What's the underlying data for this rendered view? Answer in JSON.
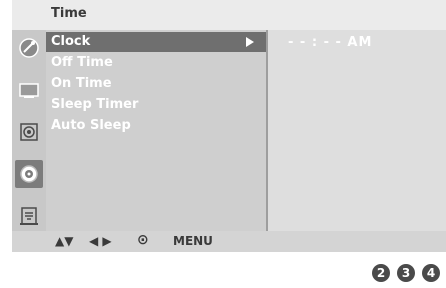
{
  "menu": {
    "title": "Time",
    "items": [
      {
        "label": "Clock",
        "selected": true
      },
      {
        "label": "Off Time",
        "selected": false
      },
      {
        "label": "On Time",
        "selected": false
      },
      {
        "label": "Sleep Timer",
        "selected": false
      },
      {
        "label": "Auto Sleep",
        "selected": false
      }
    ],
    "clock_value": "- - : - - AM"
  },
  "icons": [
    "satellite-dish-icon",
    "picture-icon",
    "sound-icon",
    "clock-icon",
    "lock-icon"
  ],
  "nav": {
    "updown": "▲▼",
    "leftright": "◀ ▶",
    "select": "⊙",
    "menu": "MENU"
  },
  "steps": [
    "2",
    "3",
    "4"
  ],
  "colors": {
    "background": "#e1e1e1",
    "selected_row": "#6f6f6f",
    "text_white": "#ffffff",
    "text_dark": "#3a3a3a",
    "step_badge": "#4a4a4a"
  }
}
